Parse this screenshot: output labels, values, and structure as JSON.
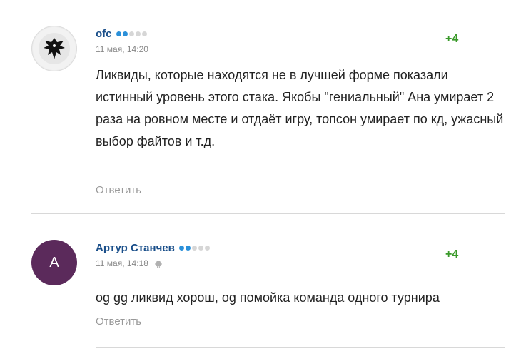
{
  "comments": [
    {
      "author": "ofc",
      "rating_dots_filled": 2,
      "rating_dots_total": 5,
      "date": "11 мая, 14:20",
      "score": "+4",
      "text": "Ликвиды, которые находятся не в лучшей форме показали истинный уровень этого стака. Якобы \"гениальный\" Ана умирает 2 раза на ровном месте и отдаёт игру, топсон умирает по кд, ужасный выбор файтов и т.д.",
      "reply_label": "Ответить",
      "avatar": "germany-emblem-icon"
    },
    {
      "author": "Артур Станчев",
      "rating_dots_filled": 2,
      "rating_dots_total": 5,
      "date": "11 мая, 14:18",
      "device_icon": "android-icon",
      "score": "+4",
      "text": "og gg ликвид хорош, og помойка команда одного турнира",
      "reply_label": "Ответить",
      "avatar_letter": "А",
      "avatar_color": "#5b2a5b"
    }
  ],
  "colors": {
    "author": "#1a4f8a",
    "score": "#3a9a2a",
    "dot_on": "#2b90d9",
    "dot_off": "#d6d6d6",
    "muted": "#999999"
  }
}
